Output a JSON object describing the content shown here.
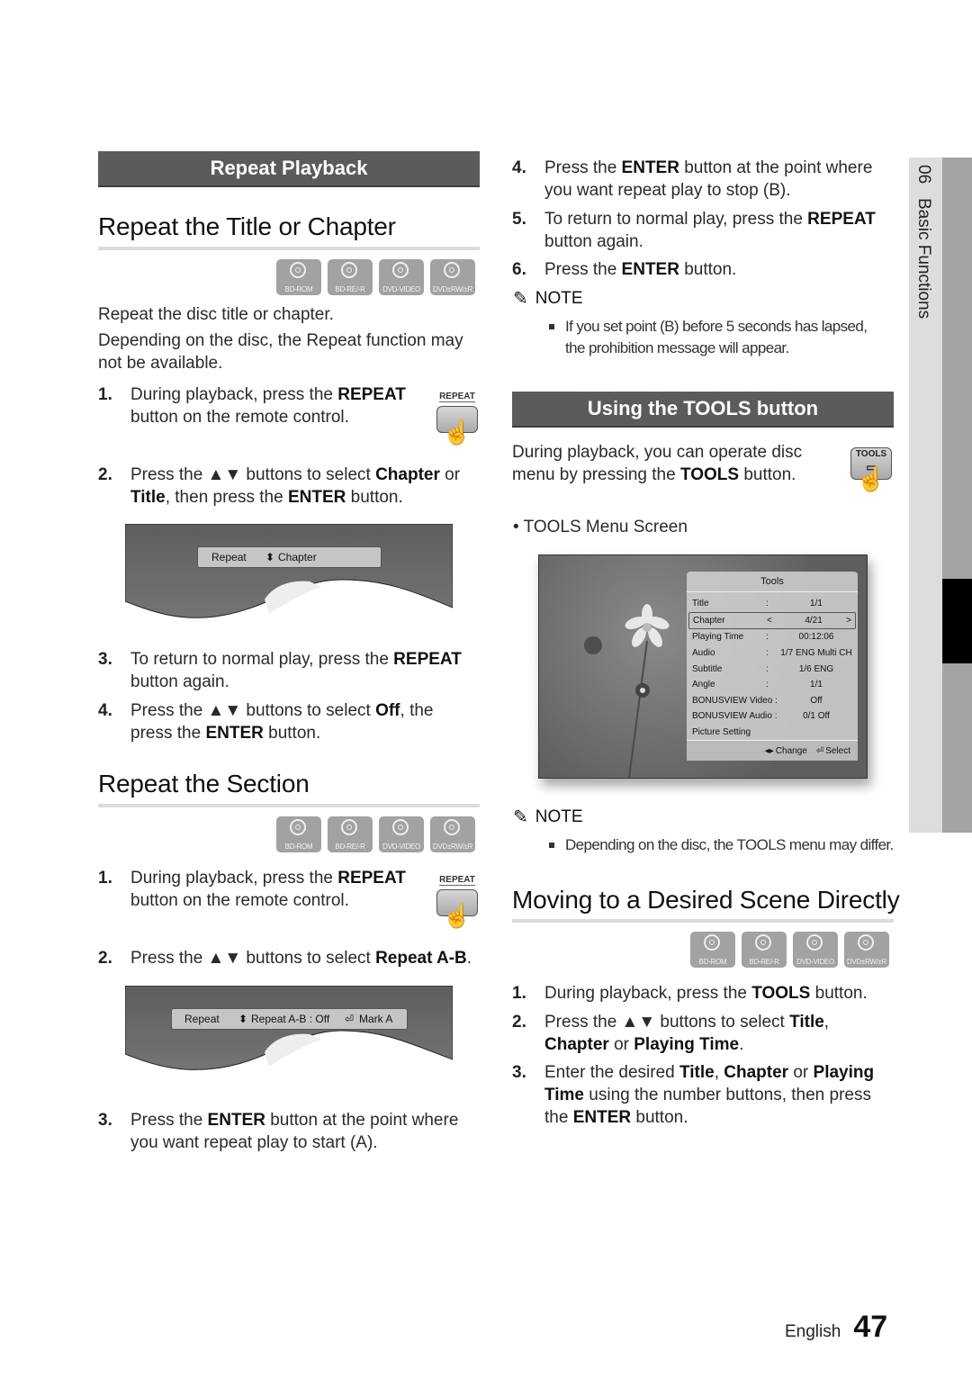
{
  "left": {
    "banner": "Repeat Playback",
    "section1": {
      "title": "Repeat the Title or Chapter",
      "discs": [
        "BD-ROM",
        "BD-RE/-R",
        "DVD-VIDEO",
        "DVD±RW/±R"
      ],
      "intro1": "Repeat the disc title or chapter.",
      "intro2": "Depending on the disc, the Repeat function may not be available.",
      "remote_label": "REPEAT",
      "steps": [
        {
          "num": "1.",
          "parts": [
            "During playback, press the ",
            "REPEAT",
            " button on the remote control."
          ]
        },
        {
          "num": "2.",
          "parts": [
            "Press the ▲▼ buttons to select ",
            "Chapter",
            " or ",
            "Title",
            ", then press the ",
            "ENTER",
            " button."
          ]
        },
        {
          "num": "3.",
          "parts": [
            "To return to normal play, press the ",
            "REPEAT",
            " button again."
          ]
        },
        {
          "num": "4.",
          "parts": [
            "Press the ▲▼ buttons to select ",
            "Off",
            ", the press the ",
            "ENTER",
            " button."
          ]
        }
      ],
      "osd": {
        "label": "Repeat",
        "arrow": "⬍",
        "value": "Chapter"
      }
    },
    "section2": {
      "title": "Repeat the Section",
      "discs": [
        "BD-ROM",
        "BD-RE/-R",
        "DVD-VIDEO",
        "DVD±RW/±R"
      ],
      "remote_label": "REPEAT",
      "steps": [
        {
          "num": "1.",
          "parts": [
            "During playback, press the ",
            "REPEAT",
            " button on the remote control."
          ]
        },
        {
          "num": "2.",
          "parts": [
            "Press the ▲▼ buttons to select ",
            "Repeat A-B",
            "."
          ]
        },
        {
          "num": "3.",
          "parts": [
            "Press the ",
            "ENTER",
            " button at the point where you want repeat play to start (A)."
          ]
        }
      ],
      "osd": {
        "label": "Repeat",
        "arrow": "⬍",
        "value": "Repeat A-B : Off",
        "enter_icon": "⏎",
        "action": "Mark A"
      }
    }
  },
  "right": {
    "steps_cont": [
      {
        "num": "4.",
        "parts": [
          "Press the ",
          "ENTER",
          " button at the point where you want repeat play to stop (B)."
        ]
      },
      {
        "num": "5.",
        "parts": [
          "To return to normal play, press the ",
          "REPEAT",
          " button again."
        ]
      },
      {
        "num": "6.",
        "parts": [
          "Press the ",
          "ENTER",
          " button."
        ]
      }
    ],
    "note1": {
      "heading": "NOTE",
      "items": [
        "If you set point (B) before 5 seconds has lapsed, the prohibition message will appear."
      ]
    },
    "banner": "Using the TOOLS button",
    "tools_intro": [
      "During playback, you can operate disc menu by pressing the ",
      "TOOLS",
      " button."
    ],
    "tools_remote_label": "TOOLS",
    "bullet": "TOOLS Menu Screen",
    "tools_menu": {
      "title": "Tools",
      "rows": [
        {
          "key": "Title",
          "sep": ":",
          "value": "1/1"
        },
        {
          "key": "Chapter",
          "sep": "<",
          "value": "4/21",
          "end": ">",
          "selected": true
        },
        {
          "key": "Playing Time",
          "sep": ":",
          "value": "00:12:06"
        },
        {
          "key": "Audio",
          "sep": ":",
          "value": "1/7 ENG Multi CH"
        },
        {
          "key": "Subtitle",
          "sep": ":",
          "value": "1/6 ENG"
        },
        {
          "key": "Angle",
          "sep": ":",
          "value": "1/1"
        },
        {
          "key": "BONUSVIEW Video :",
          "sep": "",
          "value": "Off"
        },
        {
          "key": "BONUSVIEW Audio :",
          "sep": "",
          "value": "0/1 Off"
        },
        {
          "key": "Picture Setting",
          "sep": "",
          "value": ""
        }
      ],
      "footer_change": "Change",
      "footer_select": "Select"
    },
    "note2": {
      "heading": "NOTE",
      "items": [
        "Depending on the disc, the TOOLS menu may differ."
      ]
    },
    "section3": {
      "title": "Moving to a Desired Scene Directly",
      "discs": [
        "BD-ROM",
        "BD-RE/-R",
        "DVD-VIDEO",
        "DVD±RW/±R"
      ],
      "steps": [
        {
          "num": "1.",
          "parts": [
            "During playback, press the ",
            "TOOLS",
            " button."
          ]
        },
        {
          "num": "2.",
          "parts": [
            "Press the ▲▼ buttons to select ",
            "Title",
            ", ",
            "Chapter",
            " or ",
            "Playing Time",
            "."
          ]
        },
        {
          "num": "3.",
          "parts": [
            "Enter the desired ",
            "Title",
            ", ",
            "Chapter",
            " or ",
            "Playing Time",
            " using the number buttons, then press the ",
            "ENTER",
            " button."
          ]
        }
      ]
    }
  },
  "side_tab": {
    "chapter": "06",
    "label": "Basic Functions"
  },
  "footer": {
    "language": "English",
    "page": "47"
  }
}
